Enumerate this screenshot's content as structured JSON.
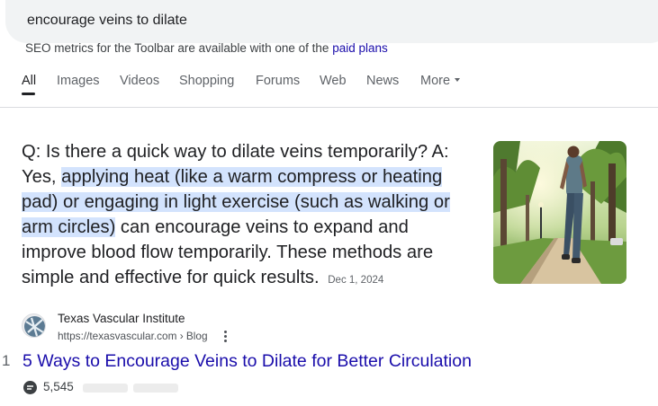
{
  "search": {
    "query": "encourage veins to dilate"
  },
  "seo_note": {
    "text": "SEO metrics for the Toolbar are available with one of the ",
    "link": "paid plans"
  },
  "tabs": [
    {
      "label": "All",
      "active": true
    },
    {
      "label": "Images"
    },
    {
      "label": "Videos"
    },
    {
      "label": "Shopping"
    },
    {
      "label": "Forums"
    },
    {
      "label": "Web"
    },
    {
      "label": "News"
    },
    {
      "label": "More"
    }
  ],
  "answer": {
    "before": "Q: Is there a quick way to dilate veins temporarily? A: Yes, ",
    "highlight": "applying heat (like a warm compress or heating pad) or engaging in light exercise (such as walking or arm circles)",
    "after": " can encourage veins to expand and improve blood flow temporarily. These methods are simple and effective for quick results.",
    "date": "Dec 1, 2024"
  },
  "thumbnail": {
    "icon": "person-walking-park-image"
  },
  "source": {
    "name": "Texas Vascular Institute",
    "url": "https://texasvascular.com › Blog",
    "icon": "texas-vascular-logo"
  },
  "result": {
    "rank": "1",
    "title": "5 Ways to Encourage Veins to Dilate for Better Circulation",
    "metric_count": "5,545"
  },
  "colors": {
    "link": "#1a0dab",
    "highlight": "#d3e3fd",
    "search_bg": "#f1f3f4"
  }
}
